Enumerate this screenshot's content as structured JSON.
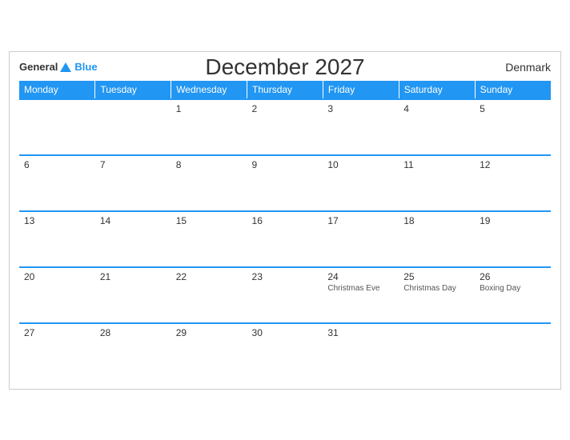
{
  "header": {
    "title": "December 2027",
    "country": "Denmark",
    "logo_general": "General",
    "logo_blue": "Blue"
  },
  "weekdays": [
    "Monday",
    "Tuesday",
    "Wednesday",
    "Thursday",
    "Friday",
    "Saturday",
    "Sunday"
  ],
  "weeks": [
    [
      {
        "day": "",
        "holiday": ""
      },
      {
        "day": "",
        "holiday": ""
      },
      {
        "day": "1",
        "holiday": ""
      },
      {
        "day": "2",
        "holiday": ""
      },
      {
        "day": "3",
        "holiday": ""
      },
      {
        "day": "4",
        "holiday": ""
      },
      {
        "day": "5",
        "holiday": ""
      }
    ],
    [
      {
        "day": "6",
        "holiday": ""
      },
      {
        "day": "7",
        "holiday": ""
      },
      {
        "day": "8",
        "holiday": ""
      },
      {
        "day": "9",
        "holiday": ""
      },
      {
        "day": "10",
        "holiday": ""
      },
      {
        "day": "11",
        "holiday": ""
      },
      {
        "day": "12",
        "holiday": ""
      }
    ],
    [
      {
        "day": "13",
        "holiday": ""
      },
      {
        "day": "14",
        "holiday": ""
      },
      {
        "day": "15",
        "holiday": ""
      },
      {
        "day": "16",
        "holiday": ""
      },
      {
        "day": "17",
        "holiday": ""
      },
      {
        "day": "18",
        "holiday": ""
      },
      {
        "day": "19",
        "holiday": ""
      }
    ],
    [
      {
        "day": "20",
        "holiday": ""
      },
      {
        "day": "21",
        "holiday": ""
      },
      {
        "day": "22",
        "holiday": ""
      },
      {
        "day": "23",
        "holiday": ""
      },
      {
        "day": "24",
        "holiday": "Christmas Eve"
      },
      {
        "day": "25",
        "holiday": "Christmas Day"
      },
      {
        "day": "26",
        "holiday": "Boxing Day"
      }
    ],
    [
      {
        "day": "27",
        "holiday": ""
      },
      {
        "day": "28",
        "holiday": ""
      },
      {
        "day": "29",
        "holiday": ""
      },
      {
        "day": "30",
        "holiday": ""
      },
      {
        "day": "31",
        "holiday": ""
      },
      {
        "day": "",
        "holiday": ""
      },
      {
        "day": "",
        "holiday": ""
      }
    ]
  ]
}
